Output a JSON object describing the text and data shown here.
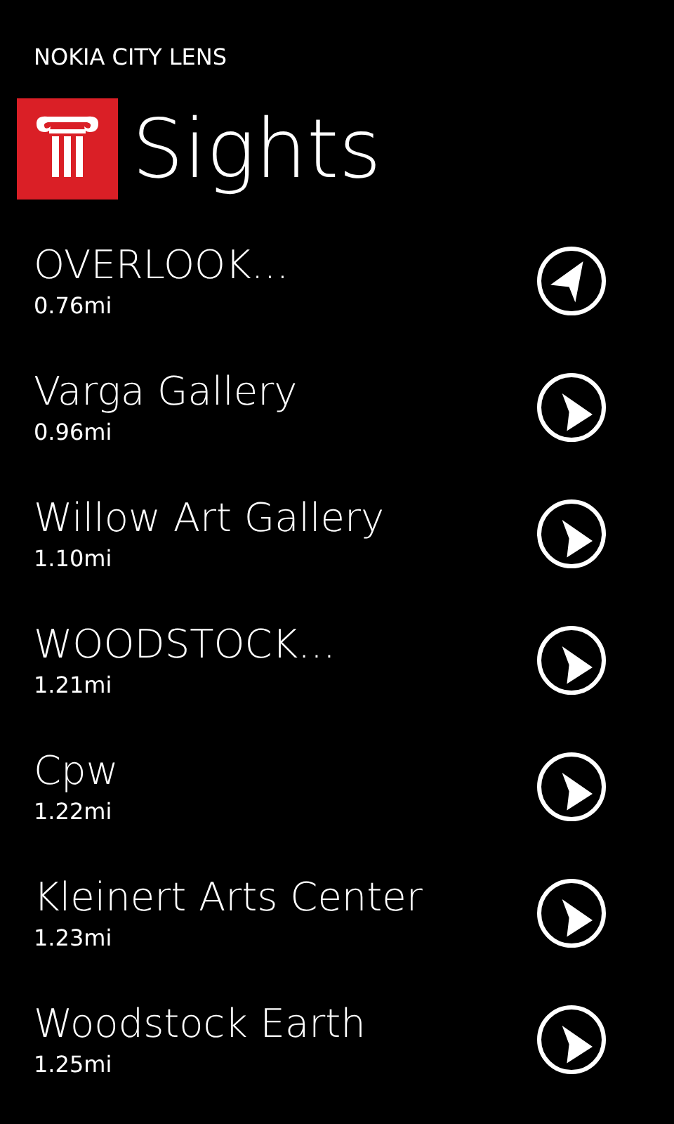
{
  "app_title": "NOKIA CITY LENS",
  "page": {
    "title": "Sights"
  },
  "places": [
    {
      "name": "OVERLOOK...",
      "distance": "0.76mi",
      "kind": "northeast"
    },
    {
      "name": "Varga Gallery",
      "distance": "0.96mi",
      "kind": "southeast"
    },
    {
      "name": "Willow Art Gallery",
      "distance": "1.10mi",
      "kind": "southeast"
    },
    {
      "name": "WOODSTOCK...",
      "distance": "1.21mi",
      "kind": "southeast"
    },
    {
      "name": "Cpw",
      "distance": "1.22mi",
      "kind": "southeast"
    },
    {
      "name": "Kleinert Arts Center",
      "distance": "1.23mi",
      "kind": "southeast"
    },
    {
      "name": "Woodstock Earth",
      "distance": "1.25mi",
      "kind": "southeast"
    }
  ]
}
